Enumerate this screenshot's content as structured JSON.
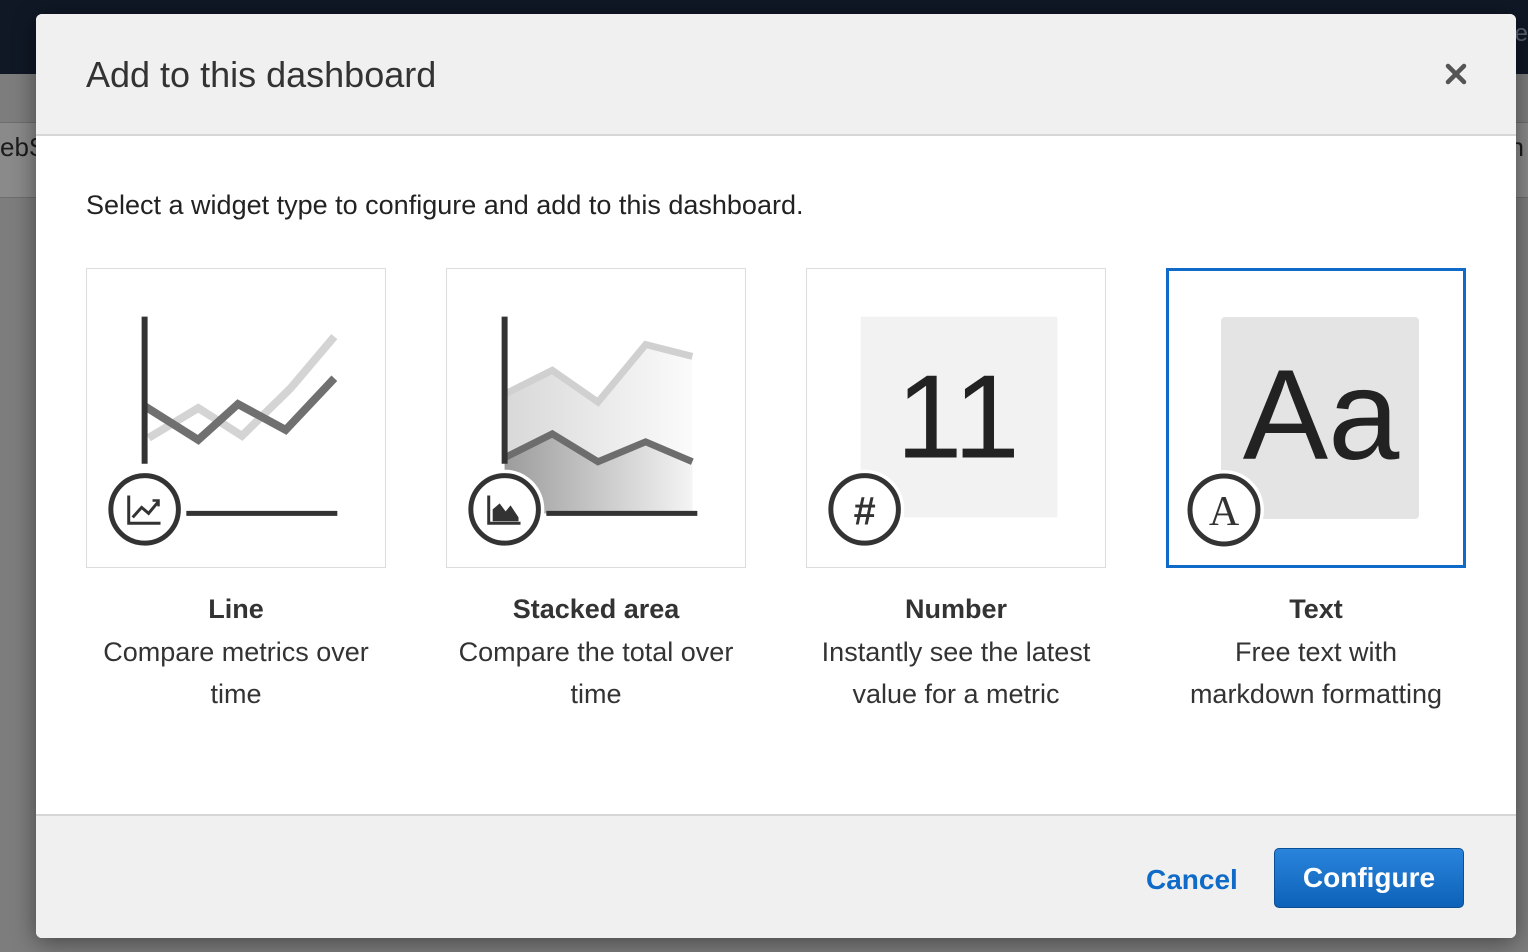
{
  "background": {
    "left_fragment": "ebS",
    "right_fragment": "n",
    "top_right_fragment": "te"
  },
  "dialog": {
    "title": "Add to this dashboard",
    "intro": "Select a widget type to configure and add to this dashboard.",
    "close_icon": "close-icon"
  },
  "widgets": [
    {
      "name": "Line",
      "description": "Compare metrics over time",
      "icon": "line-chart-icon",
      "selected": false
    },
    {
      "name": "Stacked area",
      "description": "Compare the total over time",
      "icon": "area-chart-icon",
      "selected": false
    },
    {
      "name": "Number",
      "description": "Instantly see the latest value for a metric",
      "icon": "hash-icon",
      "preview_value": "11",
      "selected": false
    },
    {
      "name": "Text",
      "description": "Free text with markdown formatting",
      "icon": "text-icon",
      "preview_text": "Aa",
      "badge_letter": "A",
      "selected": true
    }
  ],
  "footer": {
    "cancel_label": "Cancel",
    "configure_label": "Configure"
  },
  "colors": {
    "accent": "#0f6bc7",
    "selected_border": "#0f6bc7"
  }
}
